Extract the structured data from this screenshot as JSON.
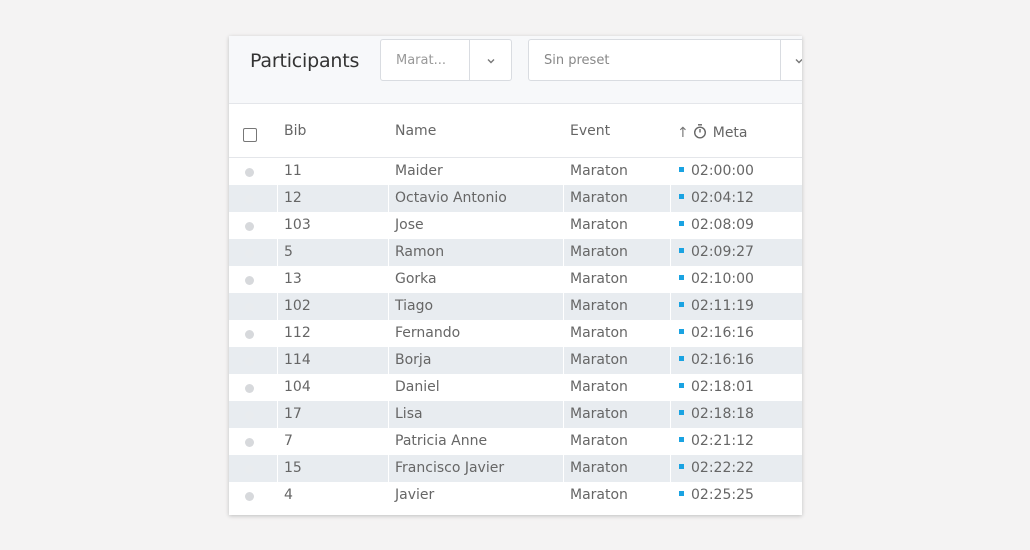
{
  "toolbar": {
    "title": "Participants",
    "event_select": {
      "value": "Marat..."
    },
    "preset_select": {
      "value": "Sin preset"
    }
  },
  "table": {
    "columns": {
      "bib": "Bib",
      "name": "Name",
      "event": "Event",
      "sort_arrow": "↑",
      "meta": "Meta"
    },
    "rows": [
      {
        "bib": "11",
        "name": "Maider",
        "event": "Maraton",
        "time": "02:00:00"
      },
      {
        "bib": "12",
        "name": "Octavio Antonio",
        "event": "Maraton",
        "time": "02:04:12"
      },
      {
        "bib": "103",
        "name": "Jose",
        "event": "Maraton",
        "time": "02:08:09"
      },
      {
        "bib": "5",
        "name": "Ramon",
        "event": "Maraton",
        "time": "02:09:27"
      },
      {
        "bib": "13",
        "name": "Gorka",
        "event": "Maraton",
        "time": "02:10:00"
      },
      {
        "bib": "102",
        "name": "Tiago",
        "event": "Maraton",
        "time": "02:11:19"
      },
      {
        "bib": "112",
        "name": "Fernando",
        "event": "Maraton",
        "time": "02:16:16"
      },
      {
        "bib": "114",
        "name": "Borja",
        "event": "Maraton",
        "time": "02:16:16"
      },
      {
        "bib": "104",
        "name": "Daniel",
        "event": "Maraton",
        "time": "02:18:01"
      },
      {
        "bib": "17",
        "name": "Lisa",
        "event": "Maraton",
        "time": "02:18:18"
      },
      {
        "bib": "7",
        "name": "Patricia Anne",
        "event": "Maraton",
        "time": "02:21:12"
      },
      {
        "bib": "15",
        "name": "Francisco Javier",
        "event": "Maraton",
        "time": "02:22:22"
      },
      {
        "bib": "4",
        "name": "Javier",
        "event": "Maraton",
        "time": "02:25:25"
      }
    ]
  },
  "colors": {
    "time_marker": "#1aa3e2",
    "alt_row": "#e8ecf0"
  },
  "icons": {
    "dropdown": "chevron-down-icon",
    "meta_column": "timer-icon"
  }
}
